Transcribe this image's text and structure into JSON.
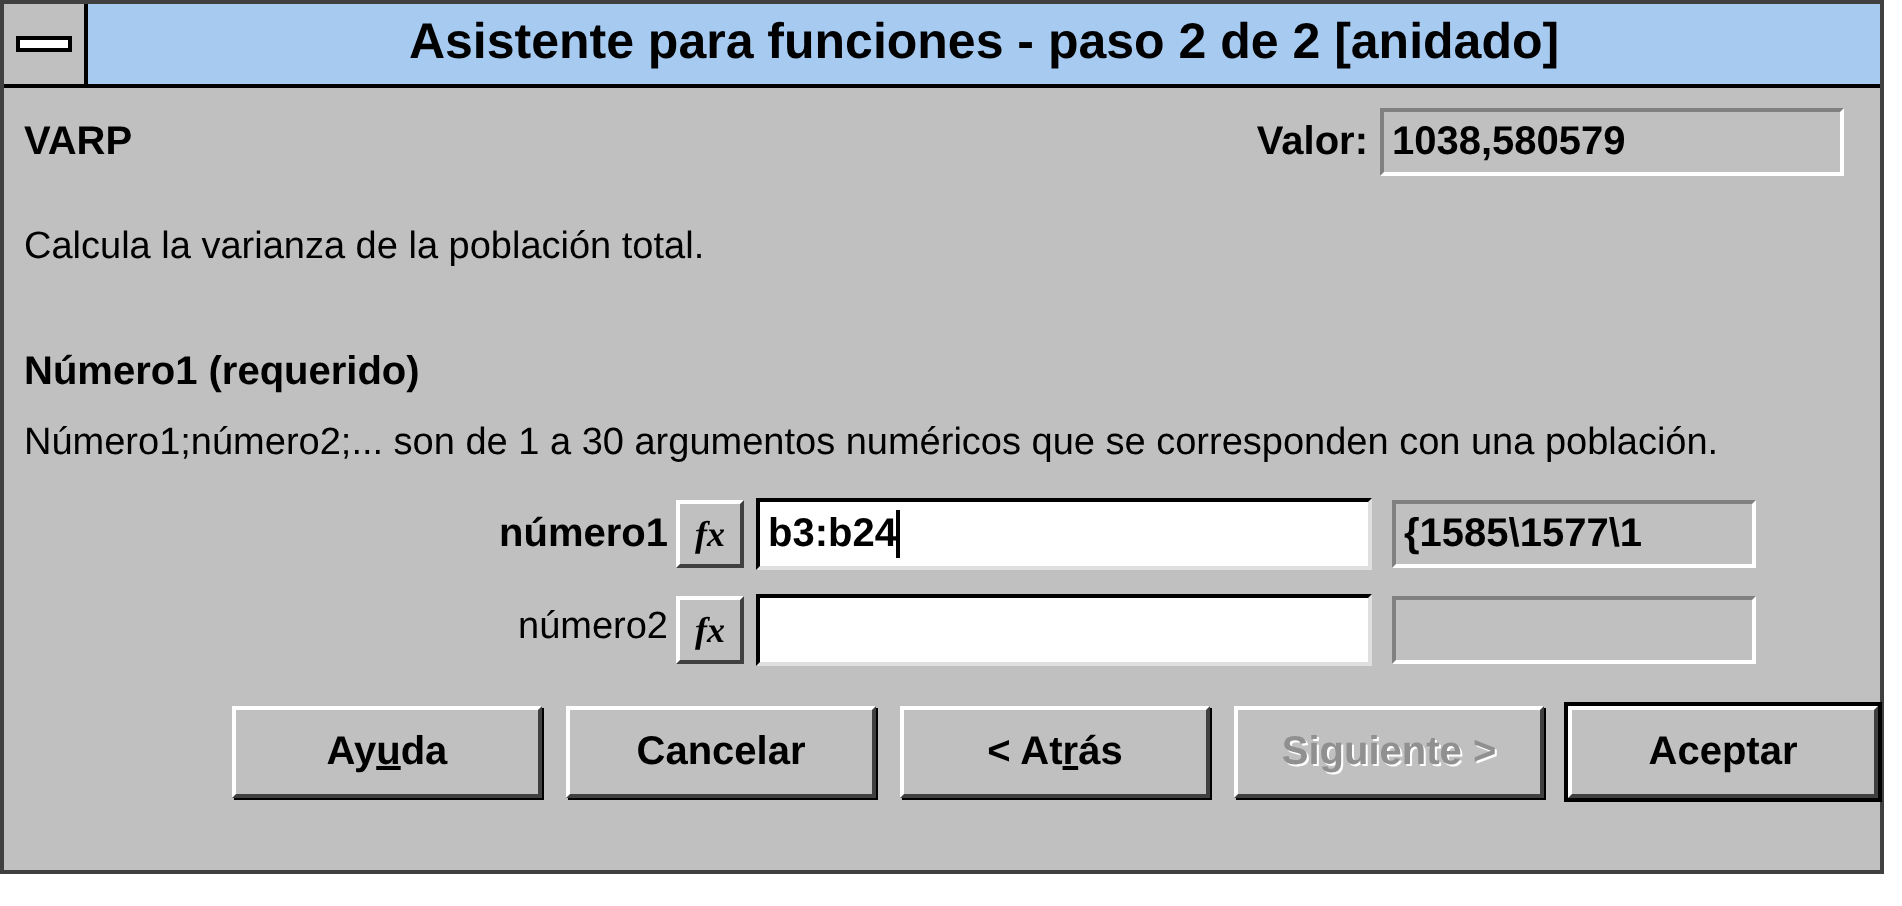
{
  "window": {
    "title": "Asistente para funciones - paso 2 de 2 [anidado]"
  },
  "function_name": "VARP",
  "value": {
    "label": "Valor:",
    "value": "1038,580579"
  },
  "description": "Calcula la varianza de la población total.",
  "argument_heading": "Número1 (requerido)",
  "argument_help": "Número1;número2;... son de 1 a 30 argumentos numéricos que se corresponden con una población.",
  "arguments": [
    {
      "label": "número1",
      "required": true,
      "fx": "fx",
      "value": "b3:b24",
      "focused": true,
      "result": "{1585\\1577\\1"
    },
    {
      "label": "número2",
      "required": false,
      "fx": "fx",
      "focused": false
    }
  ],
  "buttons": [
    {
      "label_before": "Ay",
      "mnemonic": "u",
      "label_after": "da",
      "disabled": false,
      "default": false
    },
    {
      "label_before": "Cancelar",
      "disabled": false,
      "default": false
    },
    {
      "label_before": "< At",
      "mnemonic": "r",
      "label_after": "ás",
      "disabled": false,
      "default": false
    },
    {
      "label_before": "Siguiente >",
      "disabled": true,
      "default": false
    },
    {
      "label_before": "Aceptar",
      "disabled": false,
      "default": true
    }
  ]
}
